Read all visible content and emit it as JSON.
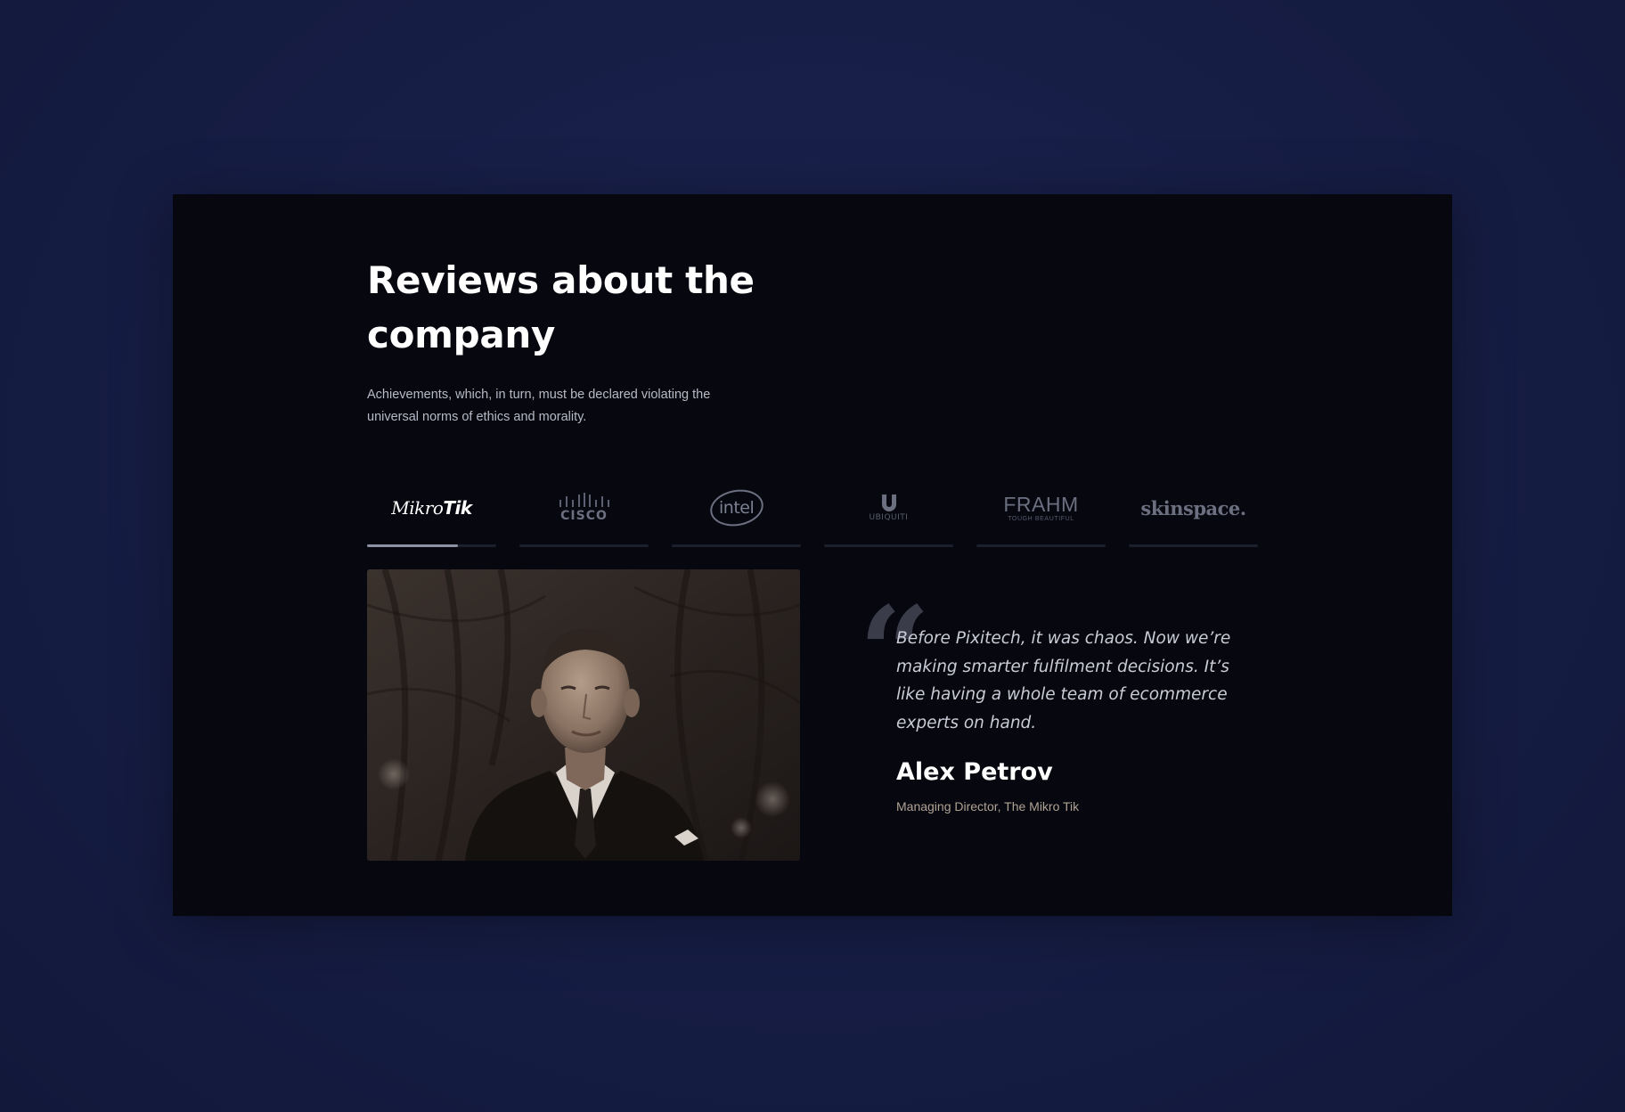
{
  "section": {
    "title": "Reviews about the company",
    "subtitle": "Achievements, which, in turn, must be declared violating the universal norms of ethics and morality."
  },
  "logos": [
    {
      "name": "MikroTik",
      "text_light": "Mikro",
      "text_bold": "Tik",
      "active": true,
      "progress": 0.7
    },
    {
      "name": "Cisco",
      "text": "CISCO",
      "active": false
    },
    {
      "name": "Intel",
      "text": "intel",
      "active": false
    },
    {
      "name": "Ubiquiti",
      "mark": "U",
      "text": "UBIQUITI",
      "active": false
    },
    {
      "name": "Frahm",
      "text": "FRAHM",
      "tagline": "TOUGH BEAUTIFUL",
      "active": false
    },
    {
      "name": "Skinspace",
      "text": "skinspace.",
      "active": false
    }
  ],
  "testimonial": {
    "quote_mark": "“",
    "quote": "Before Pixitech, it was chaos. Now we’re making smarter fulfilment decisions. It’s like having a whole team of ecommerce experts on hand.",
    "author": "Alex Petrov",
    "role": "Managing Director, The Mikro Tik"
  },
  "colors": {
    "page_background": "#161d44",
    "card_background": "#06070f",
    "title": "#ffffff",
    "active_indicator": "#8d91a3",
    "role_text": "#b0a394"
  }
}
